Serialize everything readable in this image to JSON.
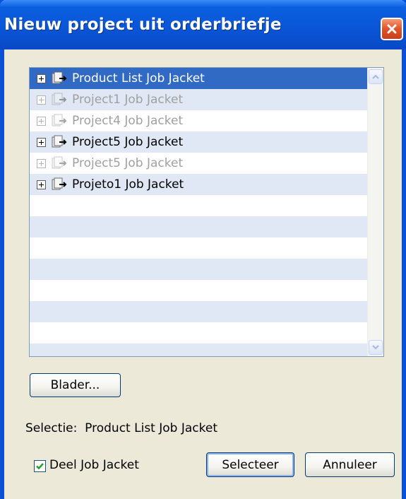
{
  "window": {
    "title": "Nieuw project uit orderbriefje"
  },
  "list": {
    "items": [
      {
        "label": "Product List Job Jacket",
        "state": "selected"
      },
      {
        "label": "Project1 Job Jacket",
        "state": "disabled"
      },
      {
        "label": "Project4 Job Jacket",
        "state": "disabled"
      },
      {
        "label": "Project5 Job Jacket",
        "state": "enabled"
      },
      {
        "label": "Project5 Job Jacket",
        "state": "disabled"
      },
      {
        "label": "Projeto1 Job Jacket",
        "state": "enabled"
      }
    ]
  },
  "browse": {
    "label": "Blader..."
  },
  "selection": {
    "prefix": "Selectie:",
    "value": "Product List Job Jacket"
  },
  "share": {
    "label": "Deel Job Jacket",
    "checked": true
  },
  "actions": {
    "select_label": "Selecteer",
    "cancel_label": "Annuleer"
  },
  "colors": {
    "titlebar": "#0a56d8",
    "selection_highlight": "#316ac5",
    "alt_row": "#dfe8f4",
    "close_button": "#e0532a"
  }
}
